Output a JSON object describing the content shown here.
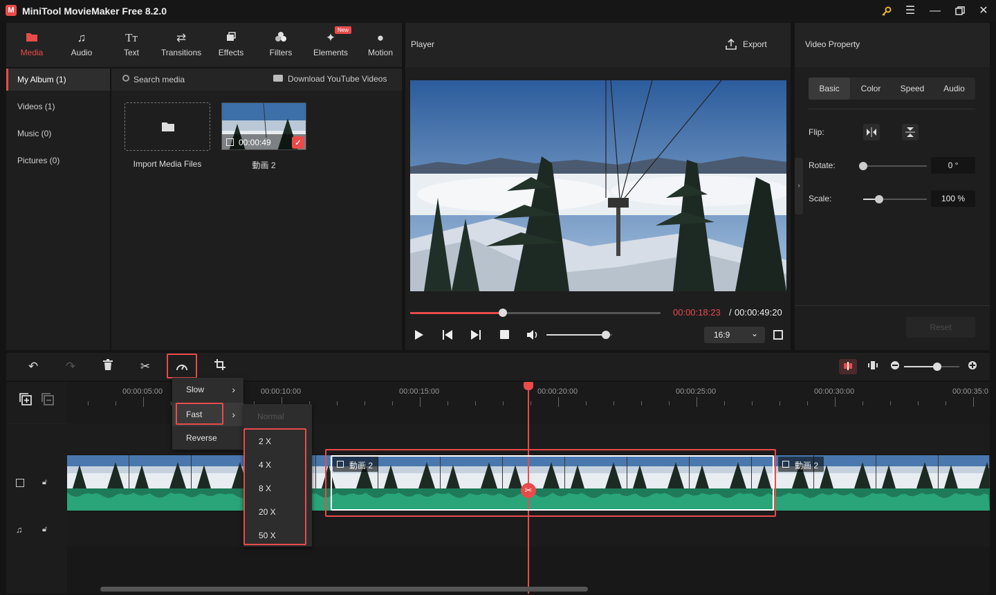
{
  "app": {
    "title": "MiniTool MovieMaker Free 8.2.0",
    "logo": "M"
  },
  "window_controls": [
    "key-icon",
    "menu-icon",
    "minimize-icon",
    "maximize-icon",
    "close-icon"
  ],
  "top_tabs": [
    {
      "label": "Media",
      "icon": "media-icon",
      "active": true
    },
    {
      "label": "Audio",
      "icon": "music-icon"
    },
    {
      "label": "Text",
      "icon": "text-icon"
    },
    {
      "label": "Transitions",
      "icon": "transitions-icon"
    },
    {
      "label": "Effects",
      "icon": "effects-icon"
    },
    {
      "label": "Filters",
      "icon": "filters-icon"
    },
    {
      "label": "Elements",
      "icon": "elements-icon",
      "badge": "New"
    },
    {
      "label": "Motion",
      "icon": "motion-icon"
    }
  ],
  "album": [
    {
      "label": "My Album (1)",
      "active": true
    },
    {
      "label": "Videos (1)"
    },
    {
      "label": "Music (0)"
    },
    {
      "label": "Pictures (0)"
    }
  ],
  "media": {
    "search_placeholder": "Search media",
    "download_label": "Download YouTube Videos",
    "import_label": "Import Media Files",
    "clip_name": "動画 2",
    "clip_duration": "00:00:49"
  },
  "player": {
    "title": "Player",
    "export_label": "Export",
    "current_time": "00:00:18:23",
    "separator": "/",
    "total_time": "00:00:49:20",
    "progress": 0.37,
    "volume": 0.9,
    "aspect_ratio": "16:9"
  },
  "property": {
    "title": "Video Property",
    "tabs": [
      "Basic",
      "Color",
      "Speed",
      "Audio"
    ],
    "active_tab": "Basic",
    "flip_label": "Flip:",
    "rotate_label": "Rotate:",
    "rotate_value": "0 °",
    "rotate_level": 0.0,
    "scale_label": "Scale:",
    "scale_value": "100 %",
    "scale_level": 0.25,
    "reset_label": "Reset"
  },
  "timeline": {
    "ruler_labels": [
      "00:00:05:00",
      "00:00:10:00",
      "00:00:15:00",
      "00:00:20:00",
      "00:00:25:00",
      "00:00:30:00",
      "00:00:35:0"
    ],
    "clip_name": "動画 2",
    "next_clip_name": "動画 2",
    "zoom_level": 0.6
  },
  "speed_menu": {
    "items": [
      "Slow",
      "Fast",
      "Reverse"
    ],
    "selected": "Fast",
    "fast_options": [
      "Normal",
      "2 X",
      "4 X",
      "8 X",
      "20 X",
      "50 X"
    ]
  },
  "colors": {
    "accent": "#e94b4b",
    "wave": "#1f7a5a",
    "bg": "#1e1e1e"
  }
}
